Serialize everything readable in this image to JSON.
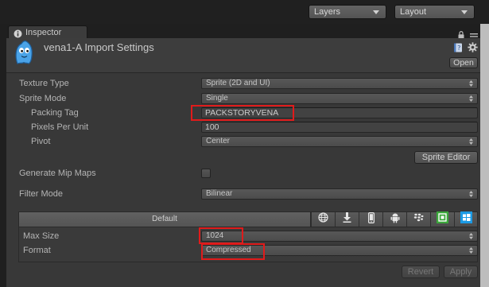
{
  "toolbar": {
    "layers_label": "Layers",
    "layout_label": "Layout",
    "dropdown_icon": "chevron-down-icon"
  },
  "tab": {
    "label": "Inspector",
    "icon": "info-icon",
    "lock_icon": "lock-icon",
    "menu_icon": "menu-icon"
  },
  "header": {
    "title": "vena1-A Import Settings",
    "asset_icon": "sprite-character-icon",
    "help_icon": "help-book-icon",
    "settings_icon": "gear-icon",
    "open_label": "Open"
  },
  "properties": {
    "texture_type": {
      "label": "Texture Type",
      "value": "Sprite (2D and UI)"
    },
    "sprite_mode": {
      "label": "Sprite Mode",
      "value": "Single"
    },
    "packing_tag": {
      "label": "Packing Tag",
      "value": "PACKSTORYVENA"
    },
    "pixels_per_unit": {
      "label": "Pixels Per Unit",
      "value": "100"
    },
    "pivot": {
      "label": "Pivot",
      "value": "Center"
    },
    "sprite_editor_label": "Sprite Editor",
    "generate_mip_maps": {
      "label": "Generate Mip Maps",
      "checked": false
    },
    "filter_mode": {
      "label": "Filter Mode",
      "value": "Bilinear"
    }
  },
  "platforms": {
    "default_label": "Default",
    "tabs": [
      {
        "icon": "globe-icon"
      },
      {
        "icon": "download-arrow-icon"
      },
      {
        "icon": "phone-icon"
      },
      {
        "icon": "android-icon"
      },
      {
        "icon": "blackberry-icon"
      },
      {
        "icon": "xbox-icon"
      },
      {
        "icon": "windows-icon"
      }
    ]
  },
  "platform_settings": {
    "max_size": {
      "label": "Max Size",
      "value": "1024"
    },
    "format": {
      "label": "Format",
      "value": "Compressed"
    }
  },
  "footer": {
    "revert_label": "Revert",
    "apply_label": "Apply",
    "enabled": false
  },
  "colors": {
    "panel_background": "#383838",
    "label_text": "#b4b4b4",
    "highlight_box": "#e01b1b",
    "xbox_green": "#3aa73a",
    "windows_blue": "#1b9ae4"
  }
}
